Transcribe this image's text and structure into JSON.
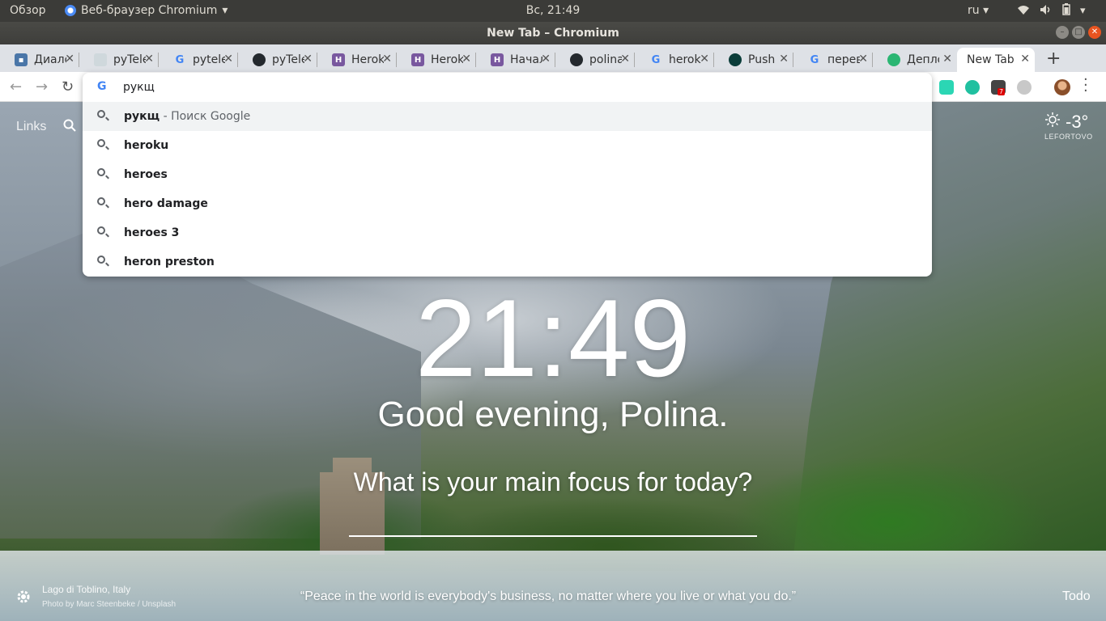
{
  "topbar": {
    "overview": "Обзор",
    "app_name": "Веб-браузер Chromium",
    "clock": "Вс, 21:49",
    "lang": "ru"
  },
  "window": {
    "title": "New Tab – Chromium"
  },
  "tabs": [
    {
      "label": "Диалоги",
      "favicon": "chat-icon",
      "color": "#4a76a8"
    },
    {
      "label": "pyTelegramBotAPI",
      "favicon": "package-icon",
      "color": "#cfd8dc"
    },
    {
      "label": "pytelegrambotapi",
      "favicon": "google-icon",
      "color": "#ffffff"
    },
    {
      "label": "pyTelegramBotAPI",
      "favicon": "github-icon",
      "color": "#24292e"
    },
    {
      "label": "Heroku",
      "favicon": "heroku-icon",
      "color": "#79589f"
    },
    {
      "label": "Heroku",
      "favicon": "heroku-icon",
      "color": "#79589f"
    },
    {
      "label": "Начало",
      "favicon": "heroku-icon",
      "color": "#79589f"
    },
    {
      "label": "polina",
      "favicon": "github-icon",
      "color": "#24292e"
    },
    {
      "label": "heroku",
      "favicon": "google-icon",
      "color": "#ffffff"
    },
    {
      "label": "Push",
      "favicon": "push-icon",
      "color": "#0b3d3a"
    },
    {
      "label": "перевод",
      "favicon": "google-icon",
      "color": "#ffffff"
    },
    {
      "label": "Деплой",
      "favicon": "deploy-icon",
      "color": "#2bb673"
    }
  ],
  "active_tab": "New Tab",
  "omnibox": {
    "value": "рукщ",
    "selected_suggestion": {
      "query": "рукщ",
      "suffix": " - Поиск Google"
    },
    "suggestions": [
      "heroku",
      "heroes",
      "hero damage",
      "heroes 3",
      "heron preston"
    ]
  },
  "extensions": {
    "badge": "7"
  },
  "momentum": {
    "links_label": "Links",
    "weather_temp": "-3°",
    "weather_location": "LEFORTOVO",
    "clock": "21:49",
    "greeting": "Good evening, Polina.",
    "focus_question": "What is your main focus for today?",
    "photo_location": "Lago di Toblino, Italy",
    "photo_credit": "Photo by Marc Steenbeke / Unsplash",
    "quote": "“Peace in the world is everybody's business, no matter where you live or what you do.”",
    "todo_label": "Todo"
  }
}
